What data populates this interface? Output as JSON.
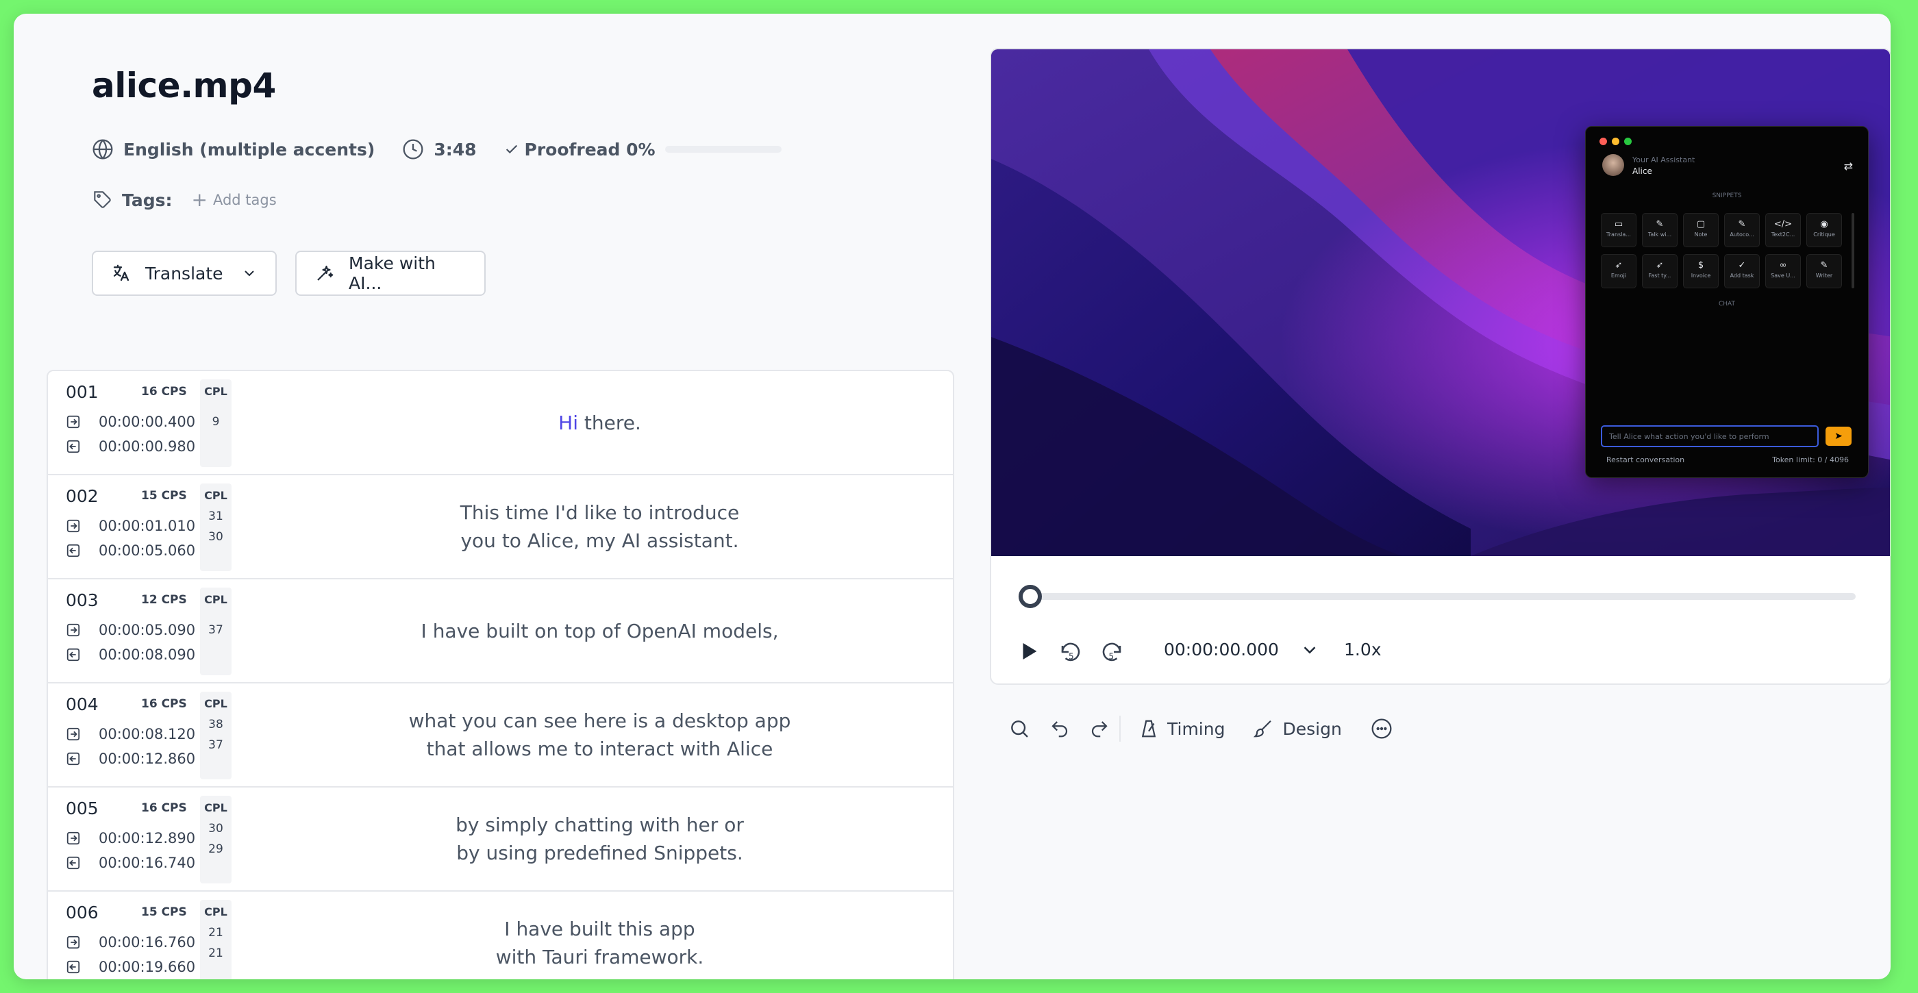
{
  "file": {
    "title": "alice.mp4",
    "language": "English (multiple accents)",
    "duration": "3:48",
    "proofread_label": "Proofread 0%",
    "proofread_progress": 0,
    "tags_label": "Tags:",
    "add_tags_label": "Add tags"
  },
  "actions": {
    "translate_label": "Translate",
    "make_ai_label": "Make with AI..."
  },
  "subtitles": [
    {
      "num": "001",
      "cps": "16 CPS",
      "cpl_label": "CPL",
      "cpl": [
        "9"
      ],
      "start": "00:00:00.400",
      "end": "00:00:00.980",
      "highlight": "Hi",
      "lines": [
        " there."
      ]
    },
    {
      "num": "002",
      "cps": "15 CPS",
      "cpl_label": "CPL",
      "cpl": [
        "31",
        "30"
      ],
      "start": "00:00:01.010",
      "end": "00:00:05.060",
      "lines": [
        "This time I'd like to introduce",
        "you to Alice, my AI assistant."
      ]
    },
    {
      "num": "003",
      "cps": "12 CPS",
      "cpl_label": "CPL",
      "cpl": [
        "37"
      ],
      "start": "00:00:05.090",
      "end": "00:00:08.090",
      "lines": [
        "I have built on top of OpenAI models,"
      ]
    },
    {
      "num": "004",
      "cps": "16 CPS",
      "cpl_label": "CPL",
      "cpl": [
        "38",
        "37"
      ],
      "start": "00:00:08.120",
      "end": "00:00:12.860",
      "lines": [
        "what you can see here is a desktop app",
        "that allows me to interact with Alice"
      ]
    },
    {
      "num": "005",
      "cps": "16 CPS",
      "cpl_label": "CPL",
      "cpl": [
        "30",
        "29"
      ],
      "start": "00:00:12.890",
      "end": "00:00:16.740",
      "lines": [
        "by simply chatting with her or",
        "by using predefined Snippets."
      ]
    },
    {
      "num": "006",
      "cps": "15 CPS",
      "cpl_label": "CPL",
      "cpl": [
        "21",
        "21"
      ],
      "start": "00:00:16.760",
      "end": "00:00:19.660",
      "lines": [
        "I have built this app",
        "with Tauri framework."
      ]
    }
  ],
  "player": {
    "timecode": "00:00:00.000",
    "speed": "1.0x",
    "seek_position": 0
  },
  "toolbar": {
    "timing_label": "Timing",
    "design_label": "Design"
  },
  "video_overlay": {
    "subtitle": "Your AI Assistant",
    "name": "Alice",
    "snippets_label": "SNIPPETS",
    "chat_label": "CHAT",
    "snippets": [
      {
        "icon": "▭",
        "label": "Transla..."
      },
      {
        "icon": "✎",
        "label": "Talk wi..."
      },
      {
        "icon": "▢",
        "label": "Note"
      },
      {
        "icon": "✎",
        "label": "Autoco..."
      },
      {
        "icon": "</>",
        "label": "Text2C..."
      },
      {
        "icon": "◉",
        "label": "Critique"
      },
      {
        "icon": "➶",
        "label": "Emoji"
      },
      {
        "icon": "➶",
        "label": "Fast ty..."
      },
      {
        "icon": "$",
        "label": "Invoice"
      },
      {
        "icon": "✓",
        "label": "Add task"
      },
      {
        "icon": "∞",
        "label": "Save U..."
      },
      {
        "icon": "✎",
        "label": "Writer"
      }
    ],
    "input_placeholder": "Tell Alice what action you'd like to perform",
    "restart_label": "Restart conversation",
    "token_label": "Token limit: 0 / 4096"
  },
  "colors": {
    "accent": "#4f46e5",
    "background": "#f8f9fb",
    "frame": "#74f56e",
    "send_button": "#f59e0b"
  }
}
